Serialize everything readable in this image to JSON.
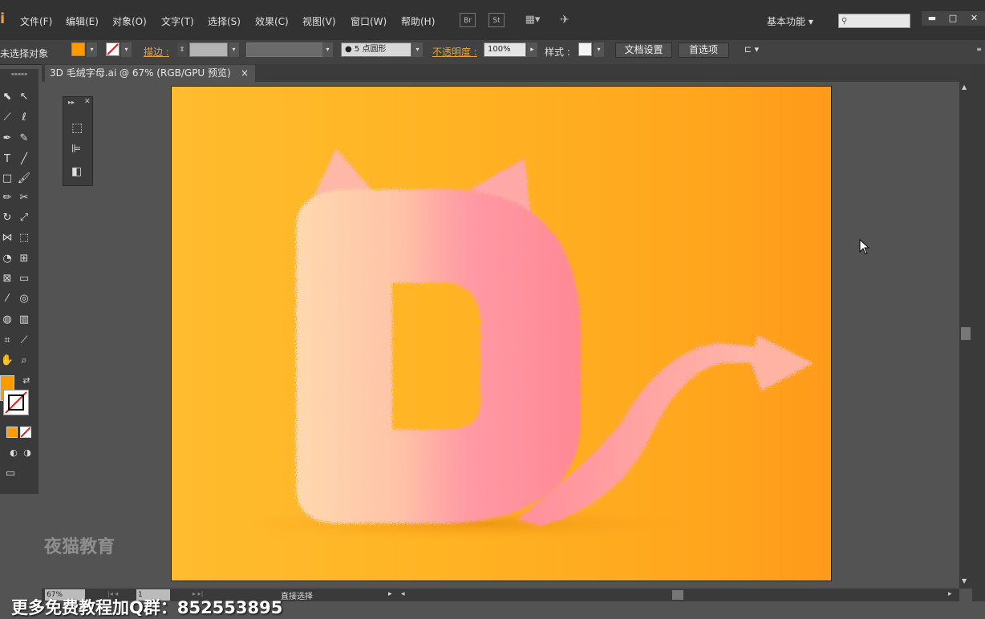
{
  "menu": {
    "logo": "i",
    "items": [
      "文件(F)",
      "编辑(E)",
      "对象(O)",
      "文字(T)",
      "选择(S)",
      "效果(C)",
      "视图(V)",
      "窗口(W)",
      "帮助(H)"
    ],
    "bridge_icon": "Br",
    "stock_icon": "St",
    "workspace": "基本功能",
    "win_minimize": "▬",
    "win_maximize": "□",
    "win_close": "✕"
  },
  "control": {
    "selection_label": "未选择对象",
    "stroke_label": "描边",
    "stroke_colon": ":",
    "brush_value": "5 点圆形",
    "opacity_label": "不透明度",
    "opacity_colon": ":",
    "opacity_value": "100%",
    "style_label": "样式",
    "style_colon": ":",
    "doc_setup_button": "文档设置",
    "preferences_button": "首选项",
    "fill_color": "#ff9a00"
  },
  "document": {
    "tab_title": "3D 毛绒字母.ai @ 67% (RGB/GPU 预览)",
    "tab_close": "×"
  },
  "status": {
    "zoom": "67%",
    "page": "1",
    "tool_status": "直接选择"
  },
  "overlay": {
    "watermark": "夜猫教育",
    "caption": "更多免费教程加Q群：852553895"
  },
  "artwork": {
    "letter": "D",
    "fur_light": "#ffd3a8",
    "fur_pink": "#ff8e9c",
    "background": "#ffad21"
  }
}
